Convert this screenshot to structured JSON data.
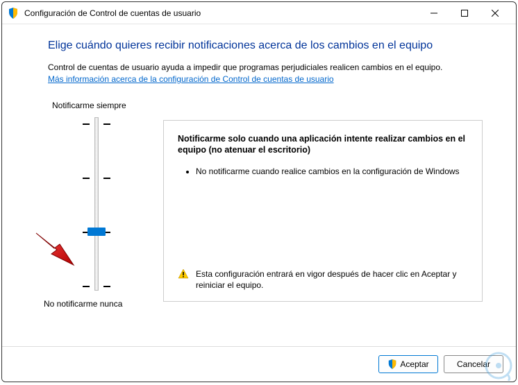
{
  "window": {
    "title": "Configuración de Control de cuentas de usuario"
  },
  "main": {
    "heading": "Elige cuándo quieres recibir notificaciones acerca de los cambios en el equipo",
    "description": "Control de cuentas de usuario ayuda a impedir que programas perjudiciales realicen cambios en el equipo.",
    "link": "Más información acerca de la configuración de Control de cuentas de usuario"
  },
  "slider": {
    "top_label": "Notificarme siempre",
    "bottom_label": "No notificarme nunca",
    "levels": 4,
    "current_level": 1
  },
  "panel": {
    "title": "Notificarme solo cuando una aplicación intente realizar cambios en el equipo (no atenuar el escritorio)",
    "bullet1": "No notificarme cuando realice cambios en la configuración de Windows",
    "warning": "Esta configuración entrará en vigor después de hacer clic en Aceptar y reiniciar el equipo."
  },
  "buttons": {
    "ok": "Aceptar",
    "cancel": "Cancelar"
  }
}
